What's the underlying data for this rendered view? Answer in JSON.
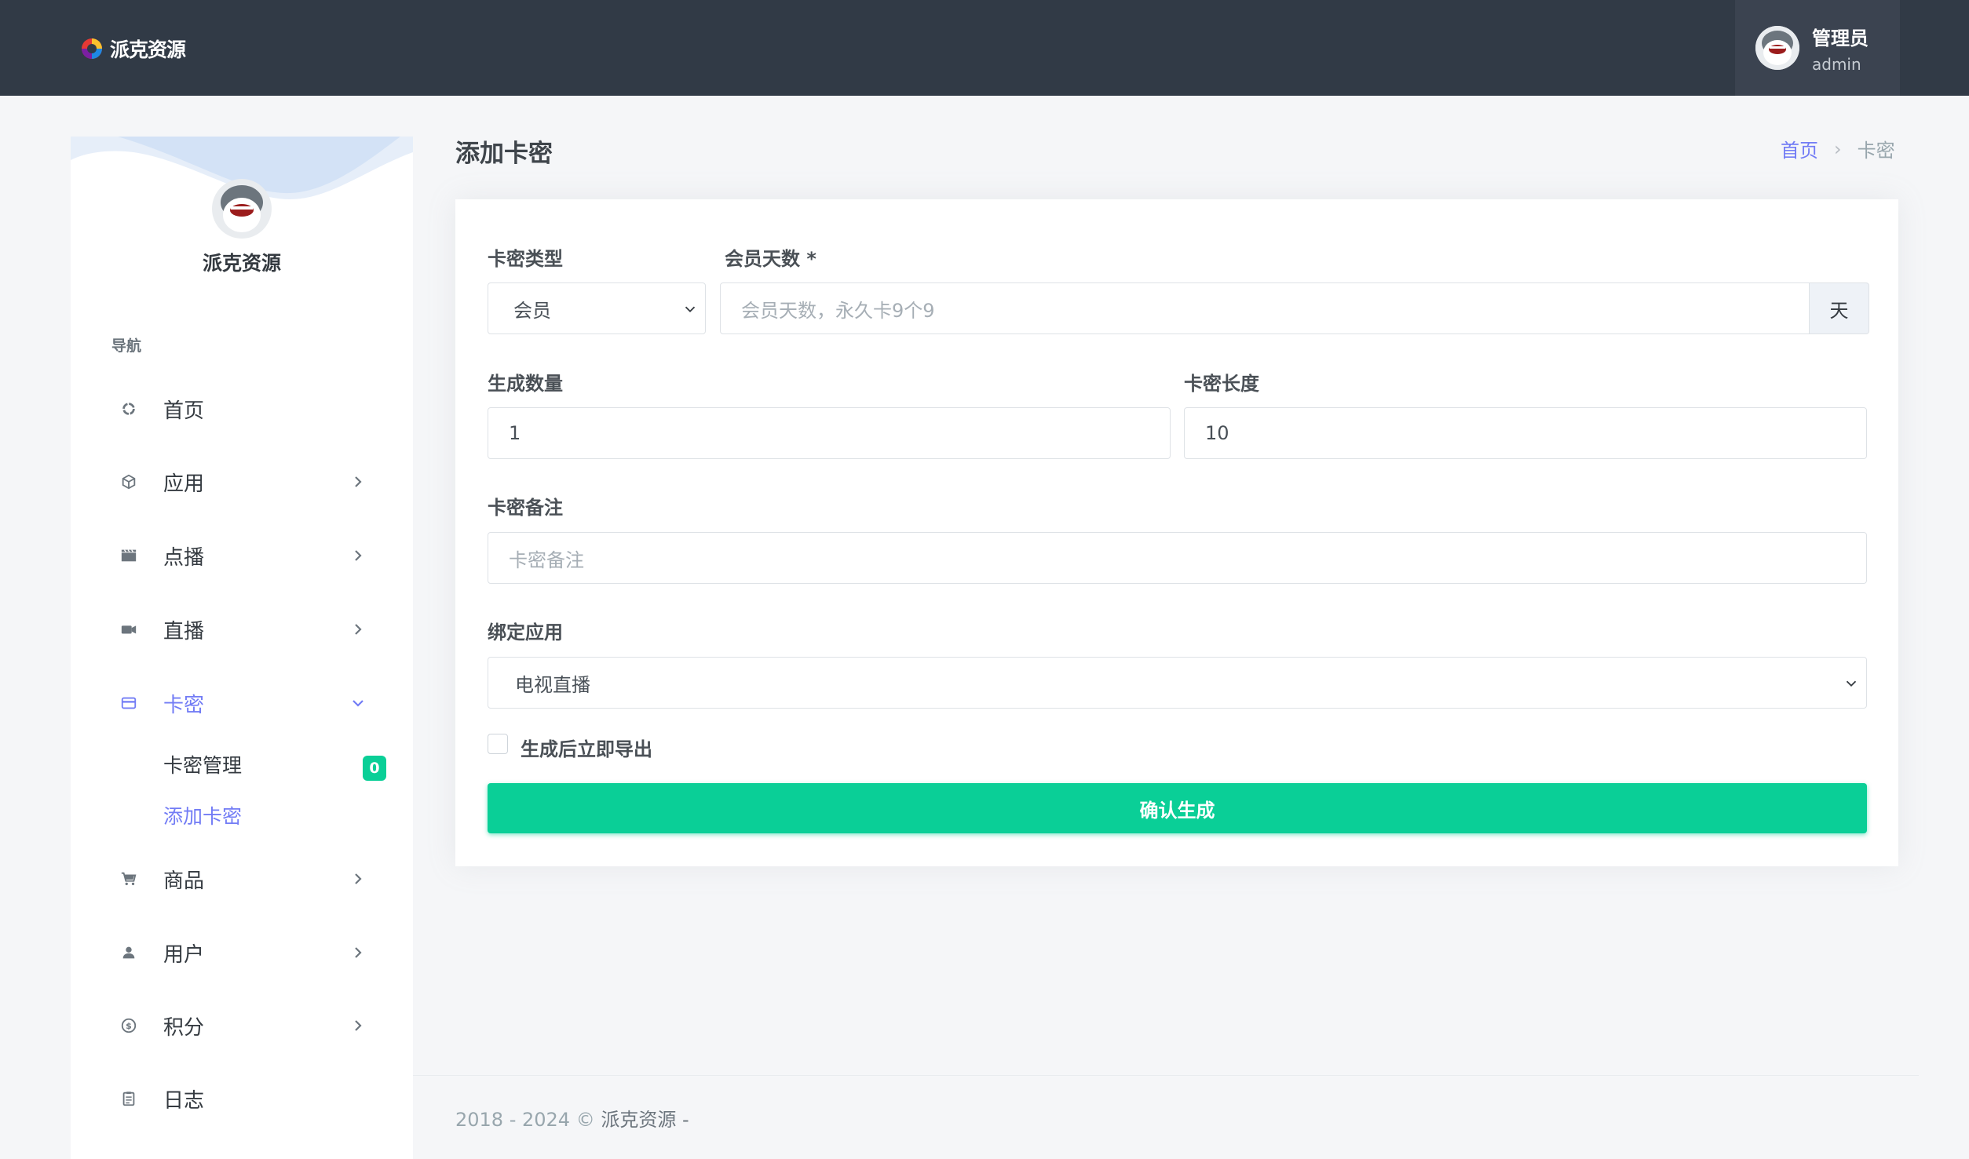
{
  "header": {
    "logo_text": "派克资源",
    "user_name": "管理员",
    "user_login": "admin"
  },
  "sidebar": {
    "site_name": "派克资源",
    "nav_title": "导航",
    "items": [
      {
        "label": "首页",
        "icon": "dashboard-icon"
      },
      {
        "label": "应用",
        "icon": "cube-icon"
      },
      {
        "label": "点播",
        "icon": "clapperboard-icon"
      },
      {
        "label": "直播",
        "icon": "video-camera-icon"
      },
      {
        "label": "卡密",
        "icon": "credit-card-icon"
      },
      {
        "label": "商品",
        "icon": "cart-icon"
      },
      {
        "label": "用户",
        "icon": "user-icon"
      },
      {
        "label": "积分",
        "icon": "coin-icon"
      },
      {
        "label": "日志",
        "icon": "clipboard-icon"
      }
    ],
    "sub_items": [
      {
        "label": "卡密管理",
        "badge": "0"
      },
      {
        "label": "添加卡密"
      }
    ]
  },
  "page": {
    "title": "添加卡密",
    "breadcrumb": [
      "首页",
      "卡密"
    ]
  },
  "form": {
    "card_type_label": "卡密类型",
    "card_type_value": "会员",
    "member_days_label": "会员天数 *",
    "member_days_placeholder": "会员天数，永久卡9个9",
    "member_days_addon": "天",
    "quantity_label": "生成数量",
    "quantity_value": "1",
    "length_label": "卡密长度",
    "length_value": "10",
    "remark_label": "卡密备注",
    "remark_placeholder": "卡密备注",
    "app_label": "绑定应用",
    "app_value": "电视直播",
    "export_label": "生成后立即导出",
    "submit_label": "确认生成"
  },
  "footer": {
    "copyright": "2018 - 2024 ©",
    "brand": "派克资源 -"
  },
  "colors": {
    "topbar": "#313a46",
    "accent": "#727cf5",
    "success": "#0acf97"
  }
}
